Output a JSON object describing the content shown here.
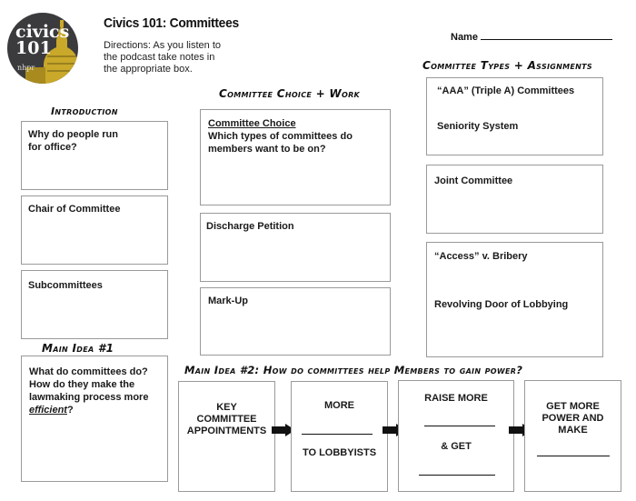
{
  "header": {
    "logo": {
      "line1": "civics",
      "line2": "101",
      "line3": "nhpr",
      "bg": "#3b3b3e",
      "accent": "#c9a82a"
    },
    "title": "Civics 101: Committees",
    "directions": [
      "Directions: As you listen to",
      "the podcast take notes in",
      "the appropriate box."
    ],
    "name_label": "Name"
  },
  "sections": {
    "introduction": {
      "heading": "Introduction",
      "boxes": [
        {
          "lines": [
            "Why do people run",
            "for office?"
          ]
        },
        {
          "lines": [
            "Chair of Committee"
          ]
        },
        {
          "lines": [
            "Subcommittees"
          ]
        }
      ]
    },
    "choice_work": {
      "heading": "Committee Choice + Work",
      "boxes": [
        {
          "title": "Committee Choice",
          "lines": [
            "Which types of committees do",
            "members want to be on?"
          ]
        },
        {
          "lines": [
            "Discharge Petition"
          ]
        },
        {
          "lines": [
            "Mark-Up"
          ]
        }
      ]
    },
    "types_assignments": {
      "heading": "Committee Types + Assignments",
      "boxes": [
        {
          "items": [
            "“AAA” (Triple A) Committees",
            "Seniority System"
          ]
        },
        {
          "items": [
            "Joint Committee"
          ]
        },
        {
          "items": [
            "“Access” v. Bribery",
            "Revolving Door of Lobbying"
          ]
        }
      ]
    },
    "main_idea_1": {
      "heading": "Main Idea #1",
      "lines": [
        "What do committees do?",
        "How do they make the",
        "lawmaking process more"
      ],
      "emphasis": "efficient",
      "suffix": "?"
    },
    "main_idea_2": {
      "heading": "Main Idea #2: How do committees help Members to gain power?",
      "steps": [
        {
          "lines": [
            "KEY",
            "COMMITTEE",
            "APPOINTMENTS"
          ]
        },
        {
          "top": "MORE",
          "bottom": "TO LOBBYISTS"
        },
        {
          "top": "RAISE MORE",
          "middle": "& GET"
        },
        {
          "lines": [
            "GET MORE",
            "POWER AND",
            "MAKE"
          ]
        }
      ],
      "arrow_icon": "right-arrow-icon"
    }
  }
}
